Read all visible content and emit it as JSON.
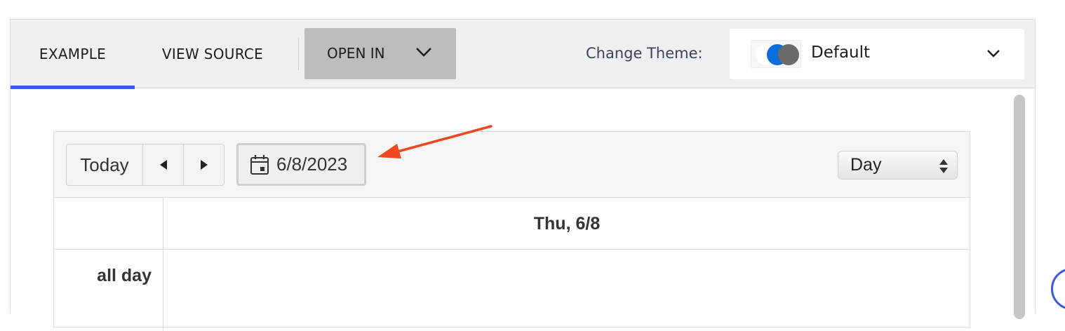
{
  "tabs": {
    "example": "EXAMPLE",
    "view_source": "VIEW SOURCE",
    "open_in": "OPEN IN"
  },
  "theme": {
    "label": "Change Theme:",
    "value": "Default",
    "swatch_colors": [
      "#ffffff",
      "#0a6fdc",
      "#6b6b6b"
    ]
  },
  "calendar": {
    "today_label": "Today",
    "prev_icon": "triangle-left-icon",
    "next_icon": "triangle-right-icon",
    "date_value": "6/8/2023",
    "view_value": "Day",
    "day_header": "Thu, 6/8",
    "allday_label": "all day"
  },
  "colors": {
    "accent": "#3b5bdb",
    "annotation_arrow": "#f0471f"
  }
}
